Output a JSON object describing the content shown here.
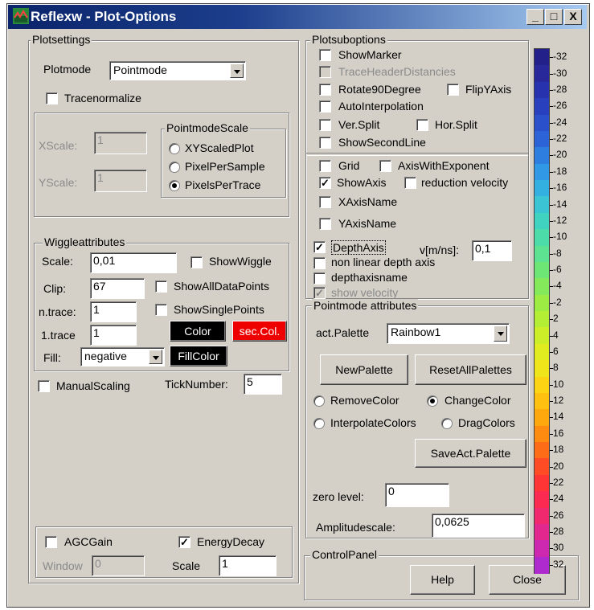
{
  "window": {
    "title": "Reflexw - Plot-Options",
    "min_btn": "_",
    "max_btn": "□",
    "close_btn": "X"
  },
  "plotsettings": {
    "title": "Plotsettings",
    "plotmode_label": "Plotmode",
    "plotmode_value": "Pointmode",
    "tracenormalize": {
      "label": "Tracenormalize",
      "checked": false
    },
    "xscale": {
      "label": "XScale:",
      "value": "1"
    },
    "yscale": {
      "label": "YScale:",
      "value": "1"
    },
    "pointmode_scale": {
      "title": "PointmodeScale",
      "options": [
        {
          "label": "XYScaledPlot",
          "selected": false
        },
        {
          "label": "PixelPerSample",
          "selected": false
        },
        {
          "label": "PixelsPerTrace",
          "selected": true
        }
      ]
    }
  },
  "wiggle": {
    "title": "Wiggleattributes",
    "scale_label": "Scale:",
    "scale_value": "0,01",
    "show_wiggle": {
      "label": "ShowWiggle",
      "checked": false
    },
    "clip_label": "Clip:",
    "clip_value": "67",
    "show_all": {
      "label": "ShowAllDataPoints",
      "checked": false
    },
    "ntrace_label": "n.trace:",
    "ntrace_value": "1",
    "show_single": {
      "label": "ShowSinglePoints",
      "checked": false
    },
    "first_label": "1.trace",
    "first_value": "1",
    "color_btn": "Color",
    "sec_color_btn": "sec.Col.",
    "fill_label": "Fill:",
    "fill_value": "negative",
    "fillcolor_btn": "FillColor"
  },
  "manual_scaling": {
    "label": "ManualScaling",
    "checked": false
  },
  "ticknumber": {
    "label": "TickNumber:",
    "value": "5"
  },
  "agc": {
    "label": "AGCGain",
    "checked": false,
    "window_label": "Window",
    "window_value": "0"
  },
  "energy": {
    "label": "EnergyDecay",
    "checked": true,
    "scale_label": "Scale",
    "scale_value": "1"
  },
  "plotsub": {
    "title": "Plotsuboptions",
    "show_marker": "ShowMarker",
    "trace_header": "TraceHeaderDistancies",
    "rotate": "Rotate90Degree",
    "flip": "FlipYAxis",
    "autointerp": "AutoInterpolation",
    "ver_split": "Ver.Split",
    "hor_split": "Hor.Split",
    "show_second": "ShowSecondLine",
    "grid": "Grid",
    "axis_exp": "AxisWithExponent",
    "show_axis": "ShowAxis",
    "reduction": "reduction velocity",
    "xaxisname": "XAxisName",
    "yaxisname": "YAxisName",
    "depthaxis": "DepthAxis",
    "velocity_label": "v[m/ns]:",
    "velocity_value": "0,1",
    "nonlinear": "non linear depth axis",
    "depthaxisname": "depthaxisname",
    "show_velocity": "show velocity"
  },
  "pointmode_attr": {
    "title": "Pointmode attributes",
    "palette_label": "act.Palette",
    "palette_value": "Rainbow1",
    "new_palette": "NewPalette",
    "reset_palettes": "ResetAllPalettes",
    "remove_color": "RemoveColor",
    "change_color": "ChangeColor",
    "interpolate": "InterpolateColors",
    "drag": "DragColors",
    "save_palette": "SaveAct.Palette",
    "zero_label": "zero level:",
    "zero_value": "0",
    "amp_label": "Amplitudescale:",
    "amp_value": "0,0625"
  },
  "control": {
    "title": "ControlPanel",
    "help": "Help",
    "close": "Close"
  },
  "colorbar": {
    "ticks": [
      "-32",
      "-30",
      "-28",
      "-26",
      "-24",
      "-22",
      "-20",
      "-18",
      "-16",
      "-14",
      "-12",
      "-10",
      "-8",
      "-6",
      "-4",
      "-2",
      "2",
      "4",
      "6",
      "8",
      "10",
      "12",
      "14",
      "16",
      "18",
      "20",
      "22",
      "24",
      "26",
      "28",
      "30",
      "32"
    ],
    "colors": [
      "#24208a",
      "#28289a",
      "#2632ae",
      "#2840be",
      "#2a50cc",
      "#2c64d8",
      "#2e7ee0",
      "#3098e4",
      "#34b0e0",
      "#3ac4d4",
      "#40d4c0",
      "#4cdcaa",
      "#5ce290",
      "#6ee676",
      "#84ea5c",
      "#9cec44",
      "#b4ee34",
      "#ccee28",
      "#e0ec20",
      "#f0e41a",
      "#fcd414",
      "#ffc010",
      "#ffa80e",
      "#ff8c10",
      "#ff6c18",
      "#ff4c24",
      "#ff3434",
      "#fa2a50",
      "#f0286e",
      "#e2288e",
      "#cc28b0",
      "#ae2ace"
    ]
  }
}
